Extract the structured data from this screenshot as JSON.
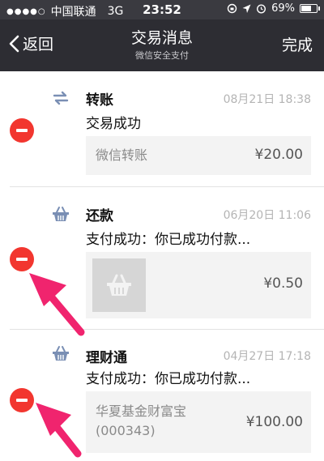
{
  "status_bar": {
    "carrier": "中国联通",
    "network": "3G",
    "time": "23:52",
    "battery_text": "69%",
    "battery_level": 0.69
  },
  "nav": {
    "back_label": "返回",
    "title": "交易消息",
    "subtitle": "微信安全支付",
    "done_label": "完成"
  },
  "messages": [
    {
      "title": "转账",
      "time": "08月21日 18:38",
      "description": "交易成功",
      "detail_name": "微信转账",
      "amount": "¥20.00",
      "icon": "transfer-icon"
    },
    {
      "title": "还款",
      "time": "06月20日 11:06",
      "description": "支付成功：你已成功付款...",
      "amount": "¥0.50",
      "icon": "basket-icon"
    },
    {
      "title": "理财通",
      "time": "04月27日 17:18",
      "description": "支付成功：你已成功付款...",
      "detail_name_line1": "华夏基金财富宝",
      "detail_name_line2": "(000343)",
      "amount": "¥100.00",
      "icon": "basket-icon"
    }
  ],
  "colors": {
    "status_bg": "#3a3a40",
    "nav_bg": "#2d2d33",
    "delete_red": "#f2362f",
    "icon_blue": "#7a8fb4",
    "arrow_pink": "#f0246e"
  }
}
